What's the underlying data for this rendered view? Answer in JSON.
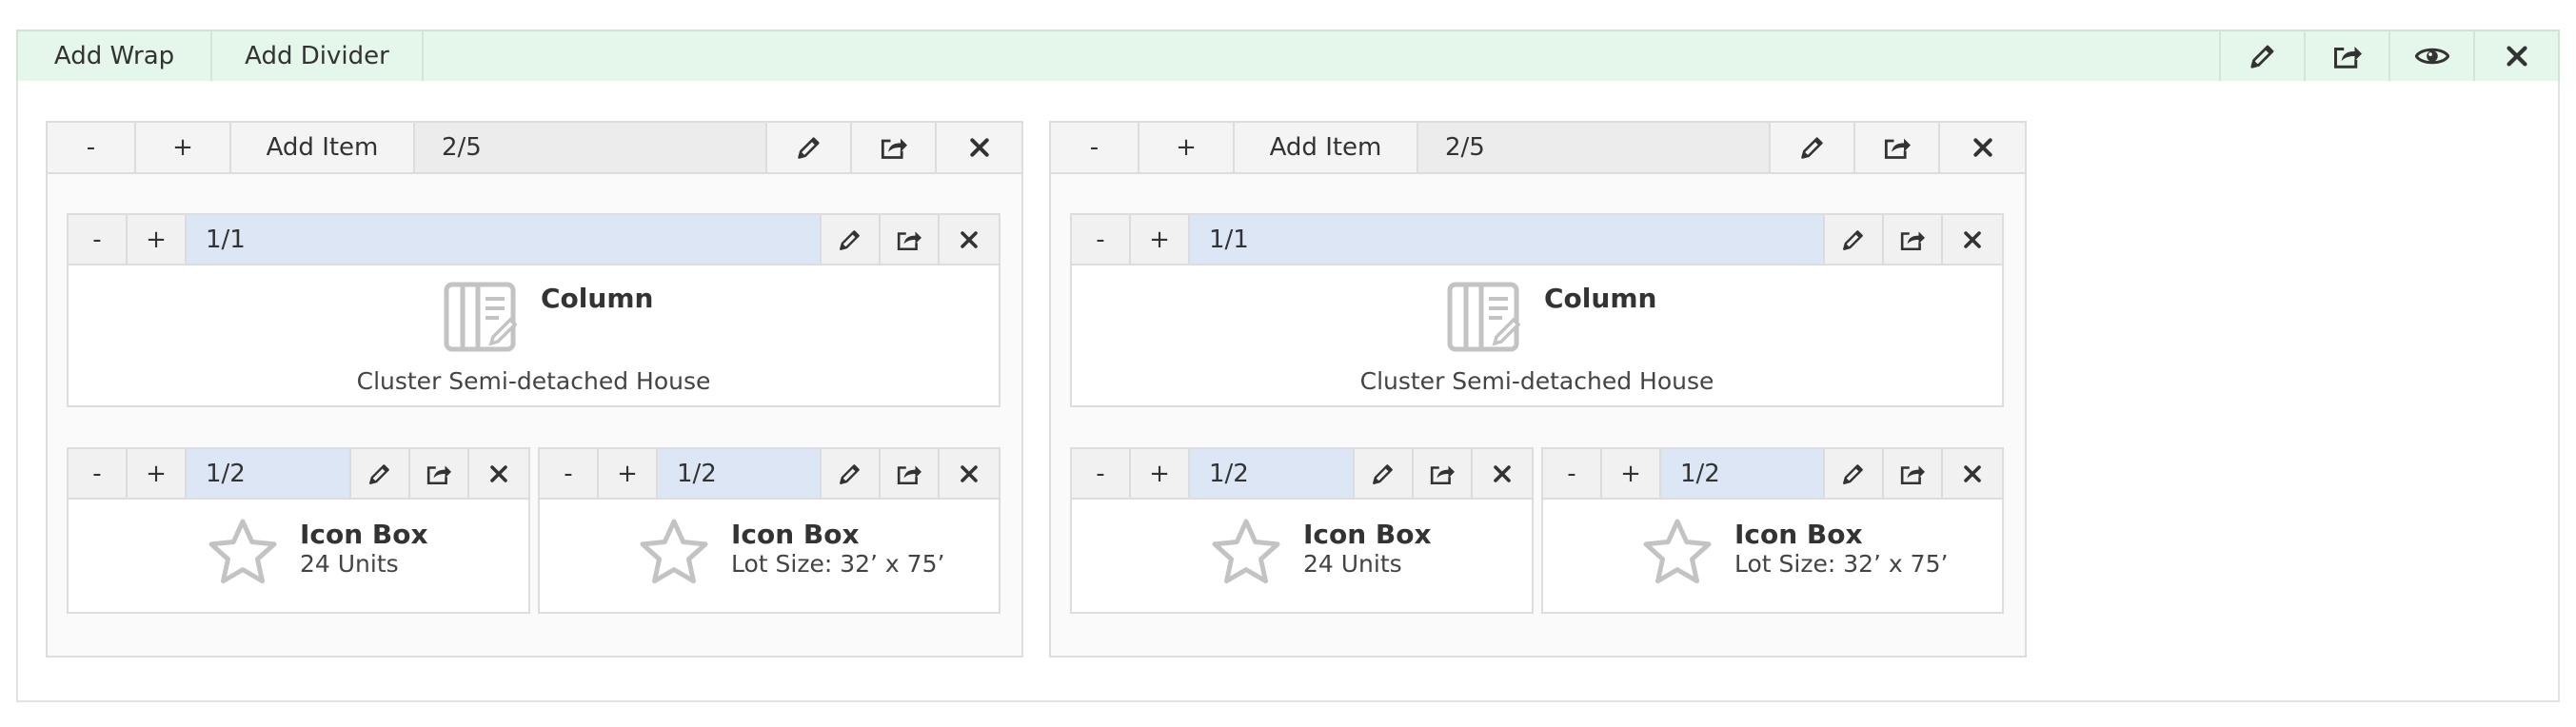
{
  "wrap": {
    "add_wrap_label": "Add Wrap",
    "add_divider_label": "Add Divider"
  },
  "rows": [
    {
      "minus_label": "-",
      "plus_label": "+",
      "add_item_label": "Add Item",
      "size_label": "2/5",
      "column": {
        "size_label": "1/1",
        "title": "Column",
        "subtitle": "Cluster Semi-detached House"
      },
      "icon_boxes": [
        {
          "size_label": "1/2",
          "title": "Icon Box",
          "subtitle": "24 Units"
        },
        {
          "size_label": "1/2",
          "title": "Icon Box",
          "subtitle": "Lot Size: 32’ x 75’"
        }
      ]
    },
    {
      "minus_label": "-",
      "plus_label": "+",
      "add_item_label": "Add Item",
      "size_label": "2/5",
      "column": {
        "size_label": "1/1",
        "title": "Column",
        "subtitle": "Cluster Semi-detached House"
      },
      "icon_boxes": [
        {
          "size_label": "1/2",
          "title": "Icon Box",
          "subtitle": "24 Units"
        },
        {
          "size_label": "1/2",
          "title": "Icon Box",
          "subtitle": "Lot Size: 32’ x 75’"
        }
      ]
    }
  ],
  "colors": {
    "wrap_toolbar_bg": "#e5f7ea",
    "column_toolbar_bg": "#dde6f5",
    "row_size_bg": "#ececec"
  },
  "icons": {
    "edit": "pencil-icon",
    "export": "share-icon",
    "preview": "eye-icon",
    "delete": "close-icon",
    "column": "column-layout-icon",
    "icon_box": "star-icon"
  }
}
